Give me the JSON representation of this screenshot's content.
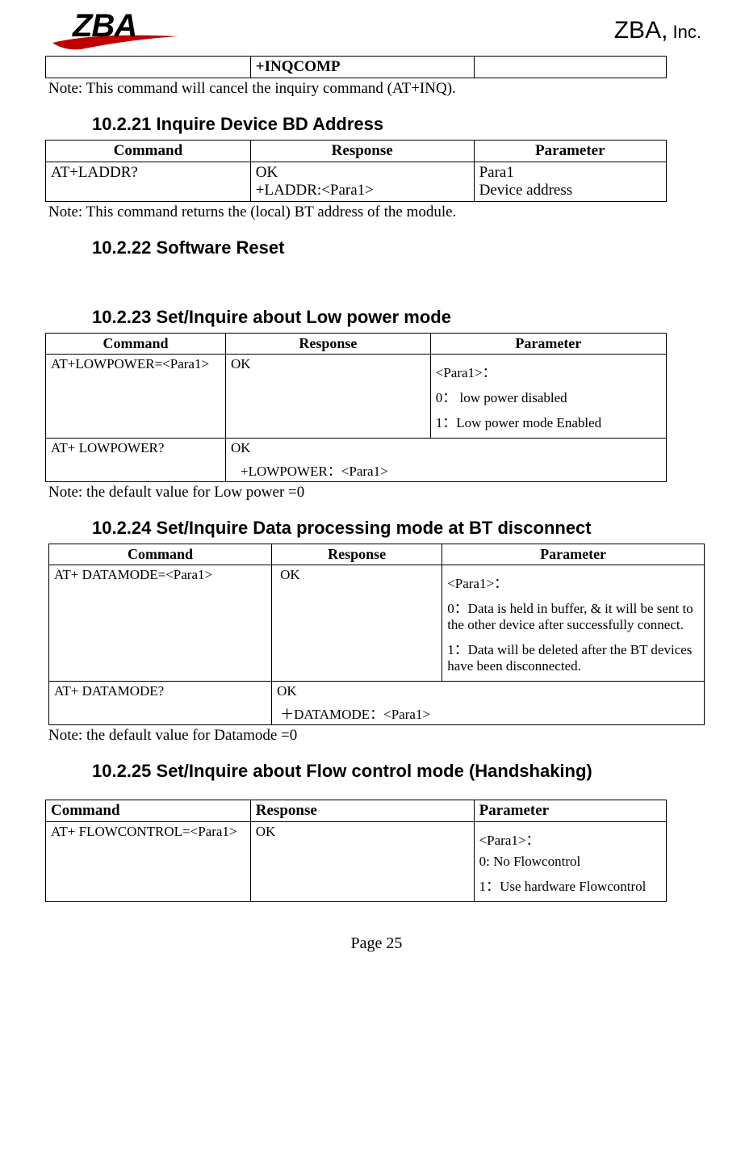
{
  "logoText": "ZBA",
  "companyName": "ZBA,",
  "companySuffix": " Inc.",
  "topTable": {
    "r1c1": "",
    "r1c2": "+INQCOMP",
    "r1c3": ""
  },
  "note0": "Note: This command will cancel the inquiry command (AT+INQ).",
  "sec21": {
    "title": "10.2.21 Inquire Device BD Address",
    "h1": "Command",
    "h2": "Response",
    "h3": "Parameter",
    "r1c1": "AT+LADDR?",
    "r1c2a": "OK",
    "r1c2b": "+LADDR:<Para1>",
    "r1c3a": "Para1",
    "r1c3b": "Device address",
    "note": "Note: This command returns the (local) BT address of the module."
  },
  "sec22": {
    "title": "10.2.22 Software Reset"
  },
  "sec23": {
    "title": "10.2.23 Set/Inquire about Low power mode",
    "h1": "Command",
    "h2": "Response",
    "h3": "Parameter",
    "r1c1": "AT+LOWPOWER=<Para1>",
    "r1c2": "OK",
    "r1p1": "<Para1>：",
    "r1p2": "0： low power disabled",
    "r1p3": "1：Low power mode Enabled",
    "r2c1": "AT+ LOWPOWER?",
    "r2c2a": "OK",
    "r2c2b": "+LOWPOWER：<Para1>",
    "note": "Note: the default value for Low power =0"
  },
  "sec24": {
    "title": "10.2.24 Set/Inquire Data processing mode at BT disconnect",
    "h1": "Command",
    "h2": "Response",
    "h3": "Parameter",
    "r1c1": "AT+ DATAMODE=<Para1>",
    "r1c2": "OK",
    "r1p1": "<Para1>：",
    "r1p2": "0：Data is held in buffer, & it will be sent to the other device after successfully connect.",
    "r1p3": "1：Data will be deleted after the BT devices have been disconnected.",
    "r2c1": "AT+ DATAMODE?",
    "r2c2a": "OK",
    "r2c2b": "＋DATAMODE：<Para1>",
    "note": "Note: the default value for Datamode =0"
  },
  "sec25": {
    "title": "10.2.25 Set/Inquire about Flow control mode (Handshaking)",
    "h1": "Command",
    "h2": "Response",
    "h3": "Parameter",
    "r1c1": "AT+ FLOWCONTROL=<Para1>",
    "r1c2": "OK",
    "r1p1": "<Para1>：",
    "r1p2": "0: No Flowcontrol",
    "r1p3": "1：Use hardware Flowcontrol"
  },
  "pageNum": "Page 25"
}
